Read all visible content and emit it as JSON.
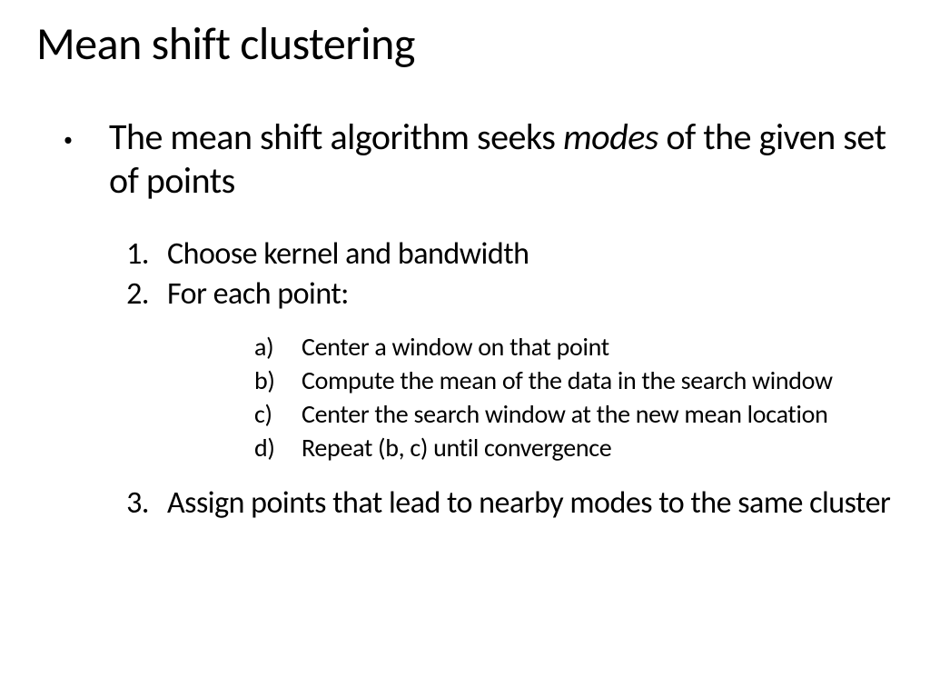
{
  "title": "Mean shift clustering",
  "bullet": {
    "pre": "The mean shift algorithm seeks ",
    "em": "modes",
    "post": " of the given set of points"
  },
  "steps": {
    "s1": {
      "n": "1.",
      "t": "Choose kernel and bandwidth"
    },
    "s2": {
      "n": "2.",
      "t": "For each point:"
    },
    "sub": {
      "a": {
        "n": "a)",
        "t": "Center a window on that point"
      },
      "b": {
        "n": "b)",
        "t": "Compute the mean of the data in the search window"
      },
      "c": {
        "n": "c)",
        "t": "Center the search window at the new mean location"
      },
      "d": {
        "n": "d)",
        "t": "Repeat (b, c) until convergence"
      }
    },
    "s3": {
      "n": "3.",
      "t": "Assign points that lead to nearby modes to the same cluster"
    }
  }
}
